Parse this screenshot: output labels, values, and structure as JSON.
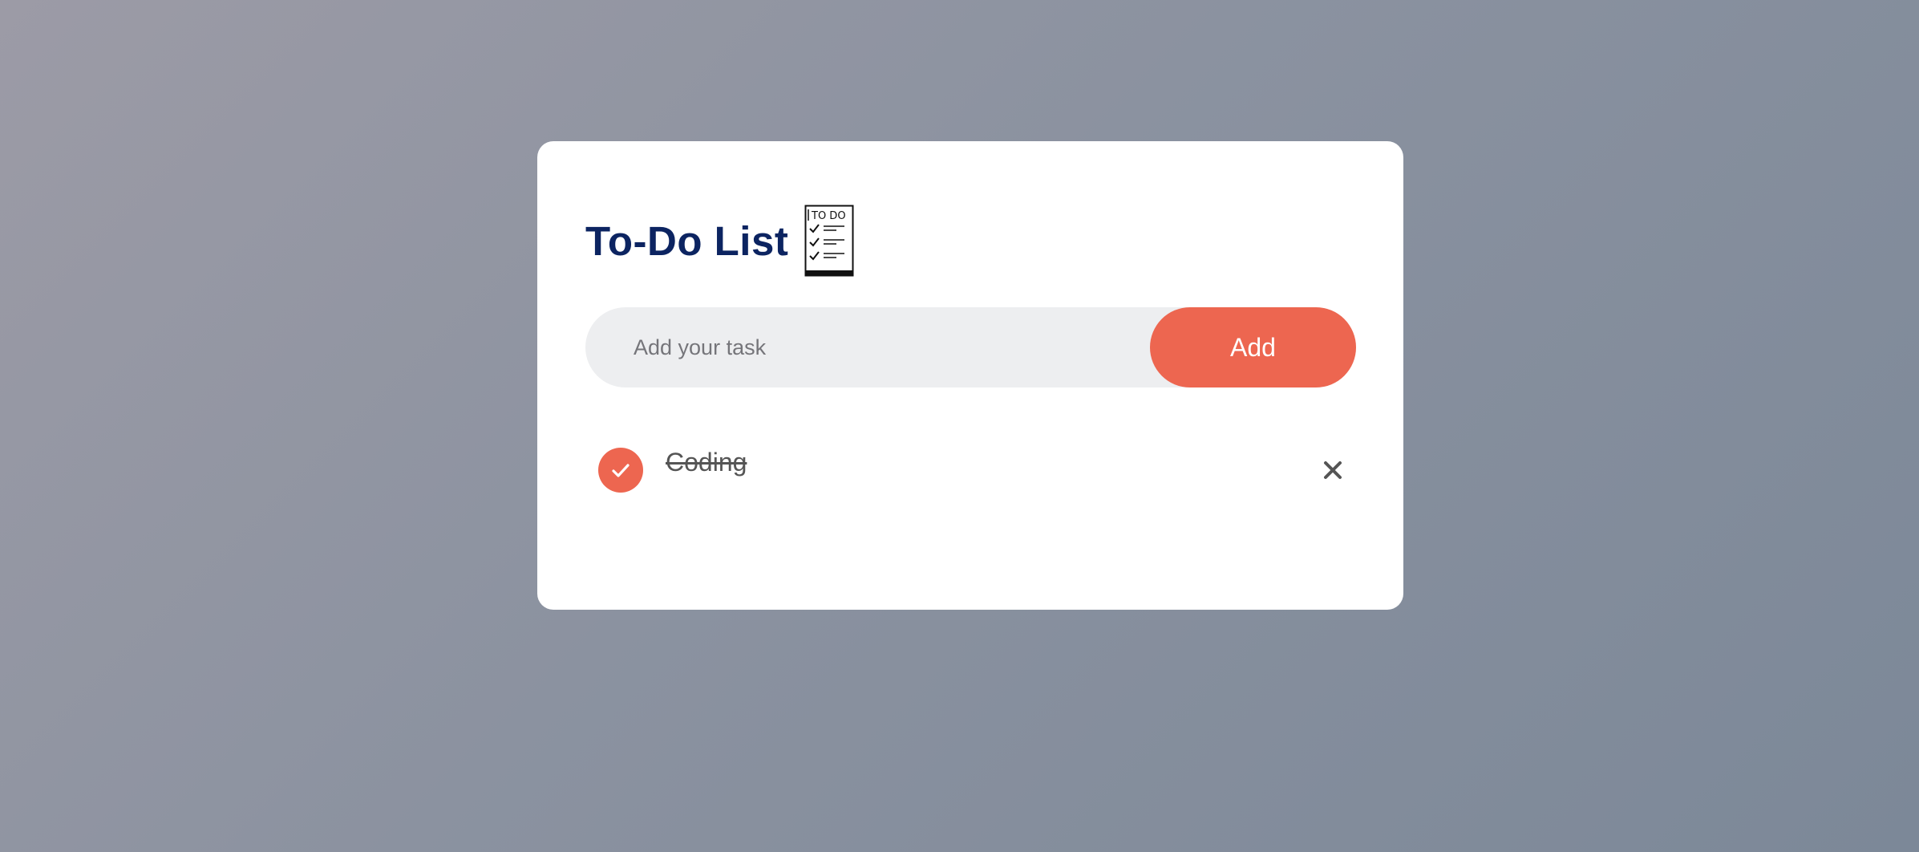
{
  "header": {
    "title": "To-Do List",
    "icon": "todo-checklist-icon"
  },
  "input": {
    "placeholder": "Add your task",
    "value": ""
  },
  "add_button": {
    "label": "Add"
  },
  "tasks": [
    {
      "text": "Coding",
      "checked": true,
      "check_icon": "checkmark-icon",
      "delete_icon": "close-icon"
    }
  ],
  "colors": {
    "accent": "#ed6650",
    "title": "#0c2461",
    "input_bg": "#edeef0",
    "task_text": "#555555"
  }
}
